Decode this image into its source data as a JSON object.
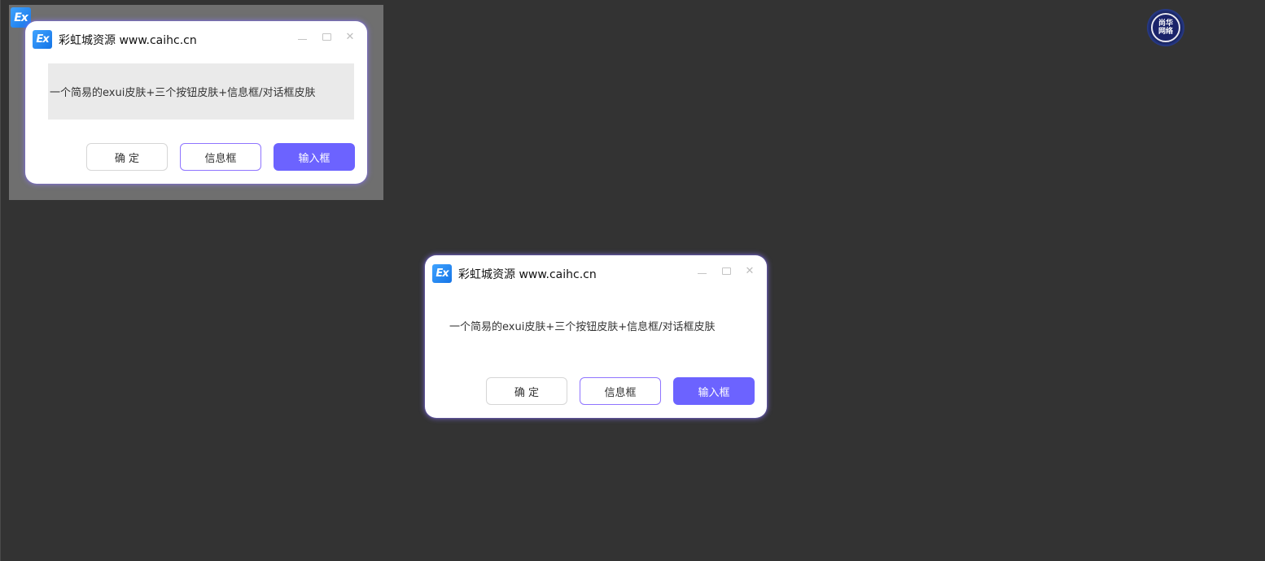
{
  "app_badge": "Ex",
  "designer": {
    "window": {
      "logo": "Ex",
      "title": "彩虹城资源 www.caihc.cn",
      "controls": {
        "minimize_icon": "minimize-icon",
        "maximize_icon": "maximize-icon",
        "close_icon": "close-icon",
        "close_glyph": "✕"
      },
      "message": "一个简易的exui皮肤+三个按钮皮肤+信息框/对话框皮肤",
      "buttons": {
        "ok": "确 定",
        "info": "信息框",
        "input": "输入框"
      }
    }
  },
  "runtime_window": {
    "logo": "Ex",
    "title": "彩虹城资源 www.caihc.cn",
    "controls": {
      "minimize_icon": "minimize-icon",
      "maximize_icon": "maximize-icon",
      "close_icon": "close-icon",
      "close_glyph": "✕"
    },
    "message": "一个简易的exui皮肤+三个按钮皮肤+信息框/对话框皮肤",
    "buttons": {
      "ok": "确 定",
      "info": "信息框",
      "input": "输入框"
    }
  },
  "avatar": {
    "line1": "尚华",
    "line2": "网络"
  },
  "colors": {
    "background": "#333333",
    "accent": "#6c63ff",
    "info_border": "#8f74ff",
    "logo_blue": "#1574e6"
  }
}
